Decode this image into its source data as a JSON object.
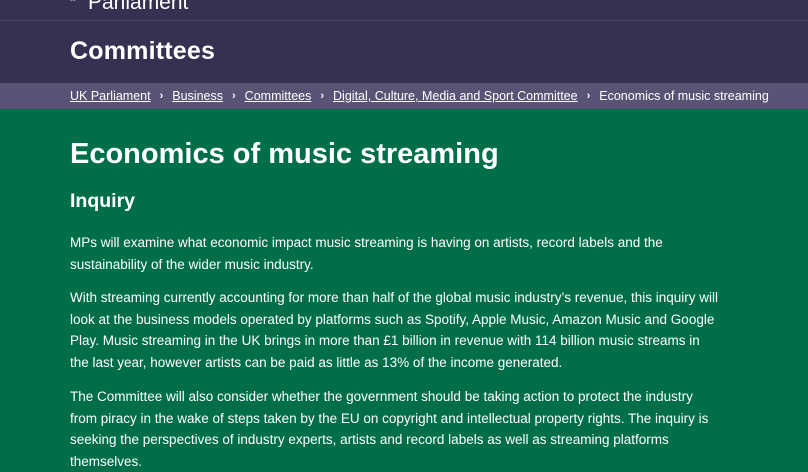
{
  "header": {
    "brand": "Parliament",
    "section_title": "Committees"
  },
  "breadcrumb": {
    "items": [
      "UK Parliament",
      "Business",
      "Committees",
      "Digital, Culture, Media and Sport Committee"
    ],
    "current": "Economics of music streaming"
  },
  "main": {
    "title": "Economics of music streaming",
    "subtitle": "Inquiry",
    "paragraphs": [
      "MPs will examine what economic impact music streaming is having on artists, record labels and the sustainability of the wider music industry.",
      "With streaming currently accounting for more than half of the global music industry’s revenue, this inquiry will look at the business models operated by platforms such as Spotify, Apple Music, Amazon Music and Google Play. Music streaming in the UK brings in more than £1 billion in revenue with 114 billion music streams in the last year, however artists can be paid as little as 13% of the income generated.",
      "The Committee will also consider whether the government should be taking action to protect the industry from piracy in the wake of steps taken by the EU on copyright and intellectual property rights. The inquiry is seeking the perspectives of industry experts, artists and record labels as well as streaming platforms themselves."
    ]
  },
  "colors": {
    "header_bg": "#373151",
    "breadcrumb_bg": "#5a5375",
    "content_bg": "#006e46"
  }
}
